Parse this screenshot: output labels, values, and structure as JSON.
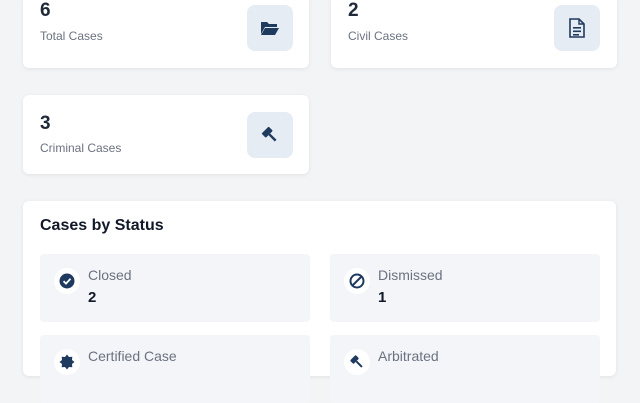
{
  "stats": [
    {
      "count": "6",
      "label": "Total Cases",
      "icon": "folder-open-icon"
    },
    {
      "count": "2",
      "label": "Civil Cases",
      "icon": "document-icon"
    },
    {
      "count": "3",
      "label": "Criminal Cases",
      "icon": "gavel-icon"
    }
  ],
  "status_section": {
    "title": "Cases by Status",
    "items": [
      {
        "label": "Closed",
        "count": "2",
        "icon": "check-circle-icon"
      },
      {
        "label": "Dismissed",
        "count": "1",
        "icon": "ban-icon"
      },
      {
        "label": "Certified Case",
        "count": "",
        "icon": "badge-certificate-icon"
      },
      {
        "label": "Arbitrated",
        "count": "",
        "icon": "gavel-icon"
      }
    ]
  },
  "colors": {
    "icon": "#1e3a5f",
    "icon_bg": "#e6ecf3",
    "page_bg": "#f3f4f6"
  }
}
